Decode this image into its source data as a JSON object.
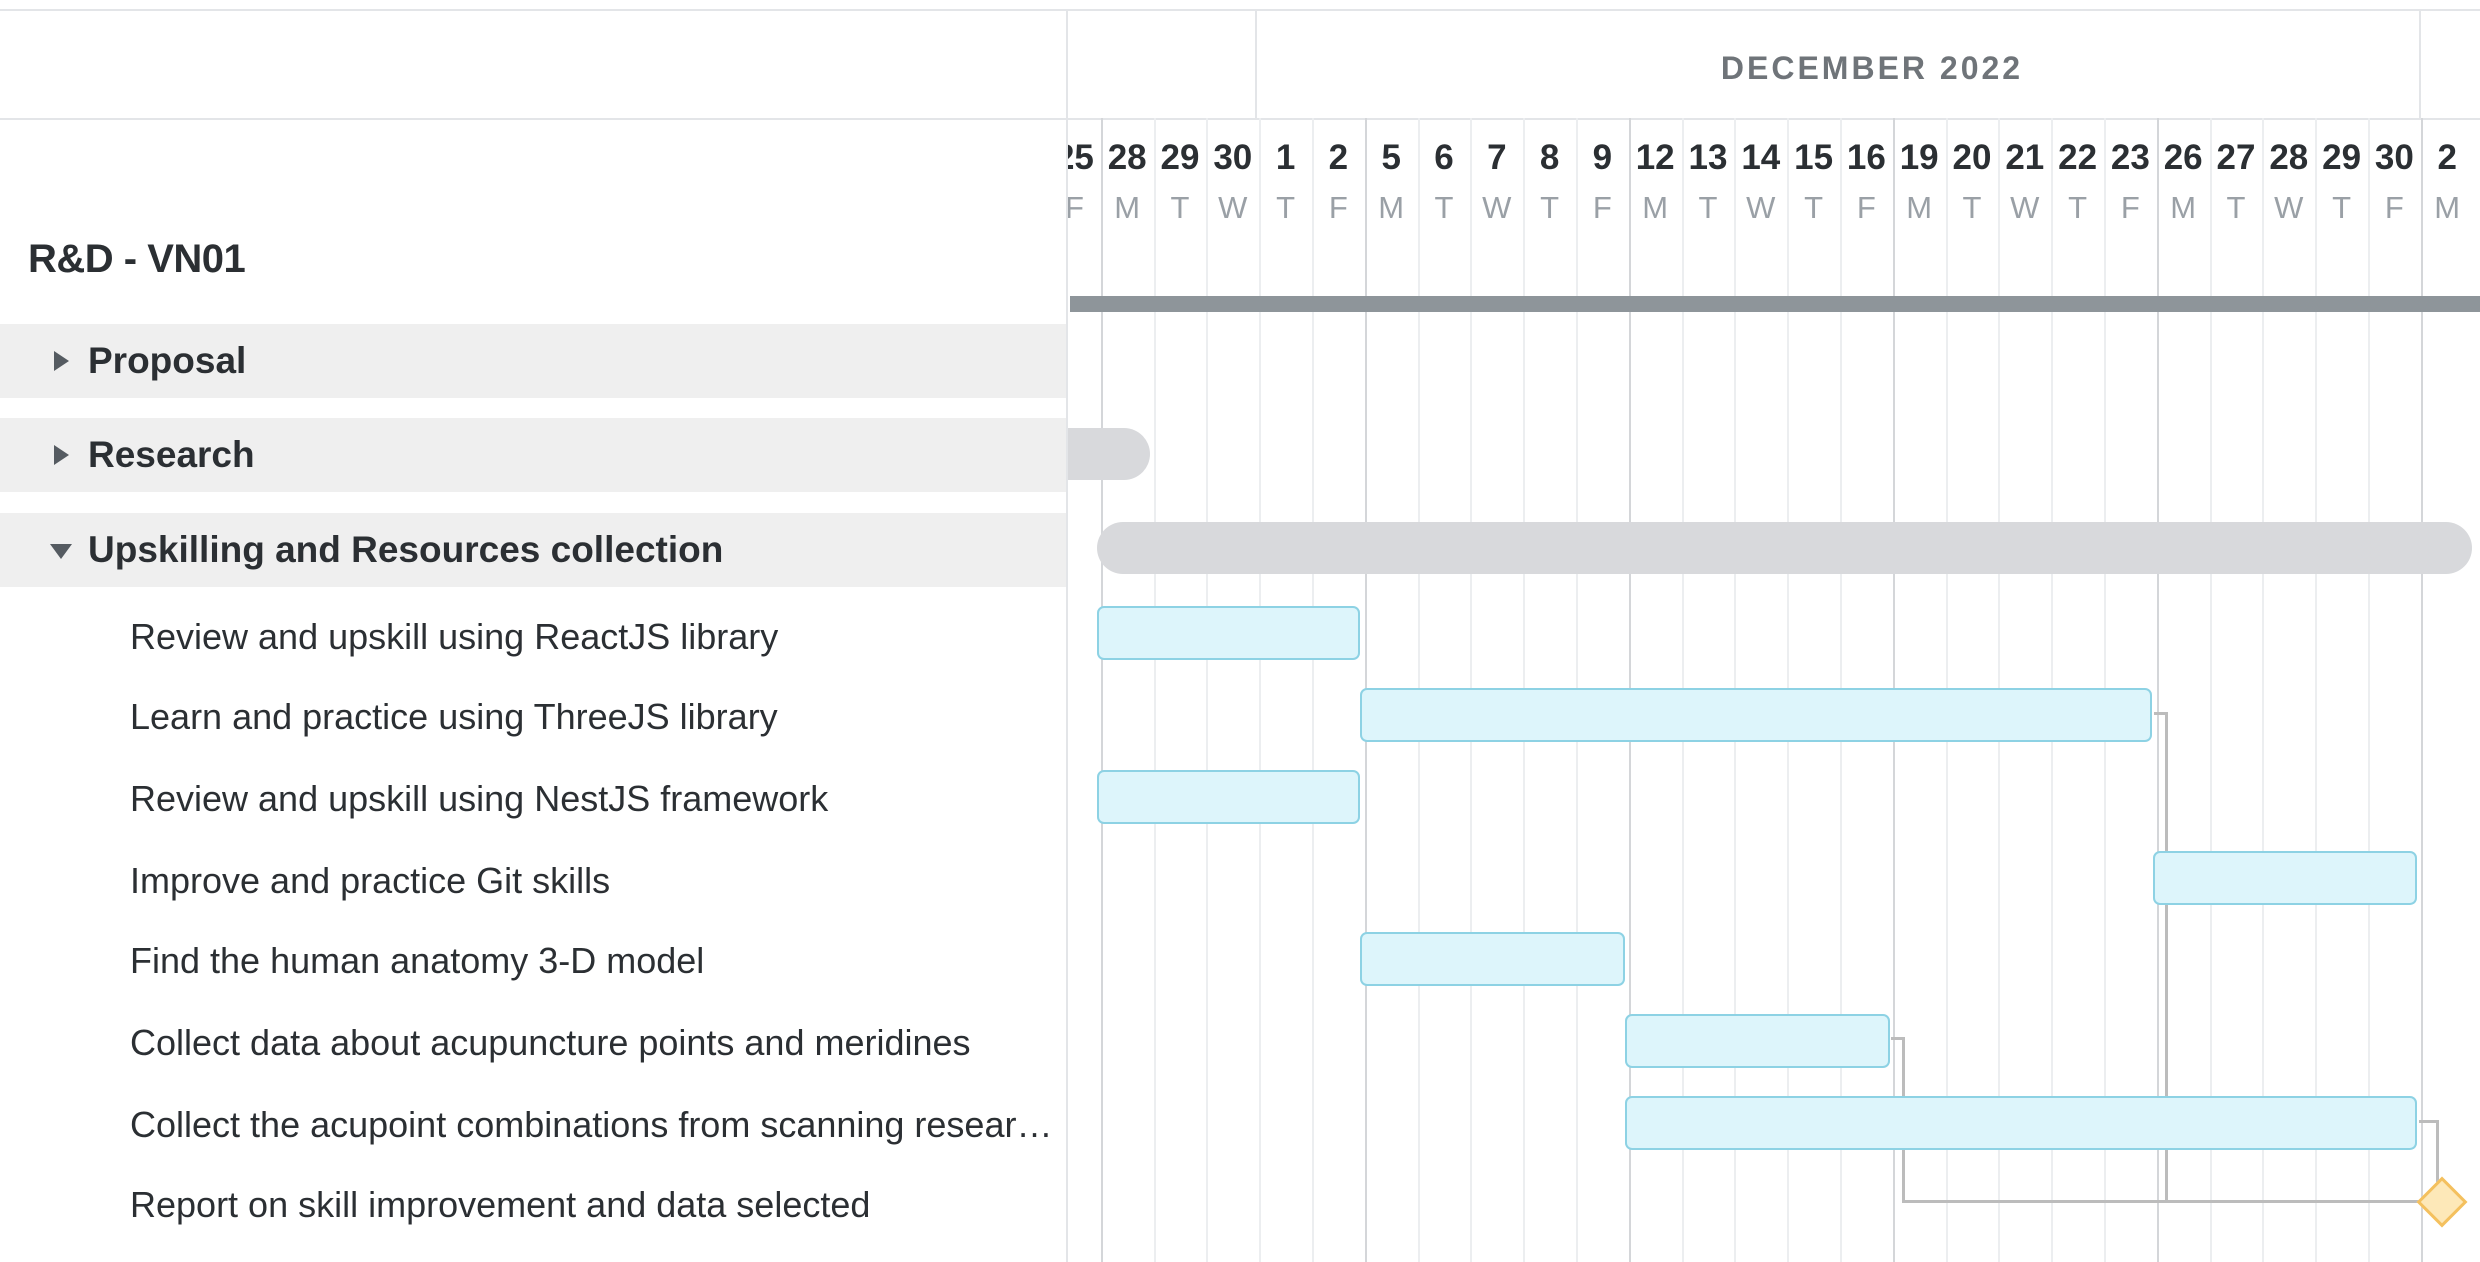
{
  "project": {
    "title": "R&D - VN01"
  },
  "timeline": {
    "month_label": "DECEMBER 2022",
    "days": [
      {
        "num": "25",
        "dow": "F"
      },
      {
        "num": "28",
        "dow": "M"
      },
      {
        "num": "29",
        "dow": "T"
      },
      {
        "num": "30",
        "dow": "W"
      },
      {
        "num": "1",
        "dow": "T"
      },
      {
        "num": "2",
        "dow": "F"
      },
      {
        "num": "5",
        "dow": "M"
      },
      {
        "num": "6",
        "dow": "T"
      },
      {
        "num": "7",
        "dow": "W"
      },
      {
        "num": "8",
        "dow": "T"
      },
      {
        "num": "9",
        "dow": "F"
      },
      {
        "num": "12",
        "dow": "M"
      },
      {
        "num": "13",
        "dow": "T"
      },
      {
        "num": "14",
        "dow": "W"
      },
      {
        "num": "15",
        "dow": "T"
      },
      {
        "num": "16",
        "dow": "F"
      },
      {
        "num": "19",
        "dow": "M"
      },
      {
        "num": "20",
        "dow": "T"
      },
      {
        "num": "21",
        "dow": "W"
      },
      {
        "num": "22",
        "dow": "T"
      },
      {
        "num": "23",
        "dow": "F"
      },
      {
        "num": "26",
        "dow": "M"
      },
      {
        "num": "27",
        "dow": "T"
      },
      {
        "num": "28",
        "dow": "W"
      },
      {
        "num": "29",
        "dow": "T"
      },
      {
        "num": "30",
        "dow": "F"
      },
      {
        "num": "2",
        "dow": "M"
      }
    ]
  },
  "groups": [
    {
      "label": "Proposal",
      "expanded": false
    },
    {
      "label": "Research",
      "expanded": false
    },
    {
      "label": "Upskilling and Resources collection",
      "expanded": true
    }
  ],
  "tasks": [
    {
      "label": "Review and upskill using ReactJS library",
      "start": "28",
      "end": "2"
    },
    {
      "label": "Learn and practice using ThreeJS library",
      "start": "5",
      "end": "23"
    },
    {
      "label": "Review and upskill using NestJS framework",
      "start": "28",
      "end": "2"
    },
    {
      "label": "Improve and practice Git skills",
      "start": "26",
      "end": "30"
    },
    {
      "label": "Find the human anatomy 3-D model",
      "start": "5",
      "end": "9"
    },
    {
      "label": "Collect data about acupuncture points and meridines",
      "start": "12",
      "end": "16"
    },
    {
      "label": "Collect the acupoint combinations from scanning research papers",
      "start": "12",
      "end": "30"
    },
    {
      "label": "Report on skill improvement and data selected",
      "milestone": "2"
    }
  ],
  "colors": {
    "task_fill": "#ddf5fb",
    "task_border": "#8dd2e4",
    "group_bar": "#d8d9dc",
    "milestone_fill": "#fde8b8",
    "milestone_border": "#f4c05e",
    "project_bar": "#8e959a",
    "dependency": "#bcbcbc"
  }
}
